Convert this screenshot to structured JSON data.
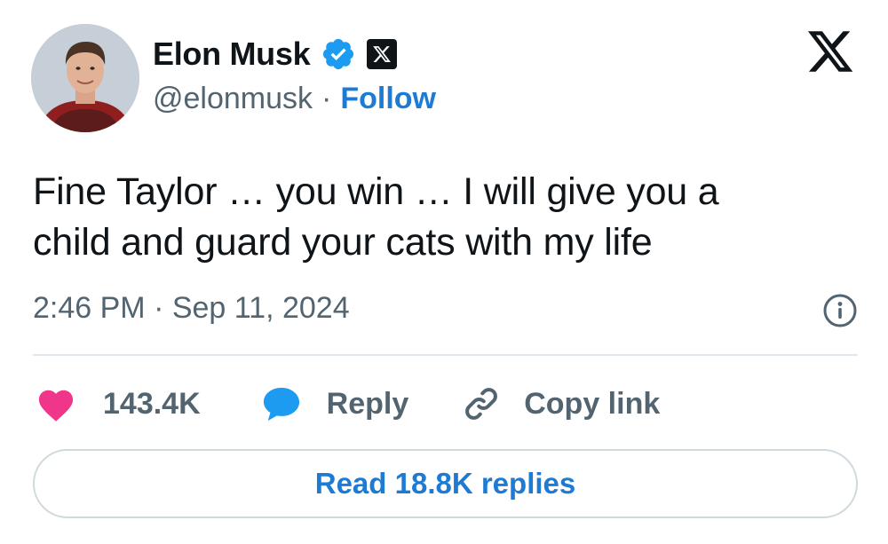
{
  "author": {
    "display_name": "Elon Musk",
    "handle": "@elonmusk",
    "separator": "·",
    "follow_label": "Follow",
    "verified_icon": "verified-badge-icon",
    "affiliation_icon": "x-logo-icon"
  },
  "tweet": {
    "text_line1": "Fine Taylor … you win … I will give you a",
    "text_line2": "child and guard your cats with my life",
    "timestamp": "2:46 PM · Sep 11, 2024"
  },
  "actions": {
    "like_count": "143.4K",
    "reply_label": "Reply",
    "copy_link_label": "Copy link"
  },
  "footer": {
    "read_replies_label": "Read 18.8K replies"
  },
  "colors": {
    "accent": "#1d7bd4",
    "like": "#f0368b",
    "reply_bubble": "#1d9bf0",
    "muted": "#536471",
    "text": "#0f1419"
  }
}
